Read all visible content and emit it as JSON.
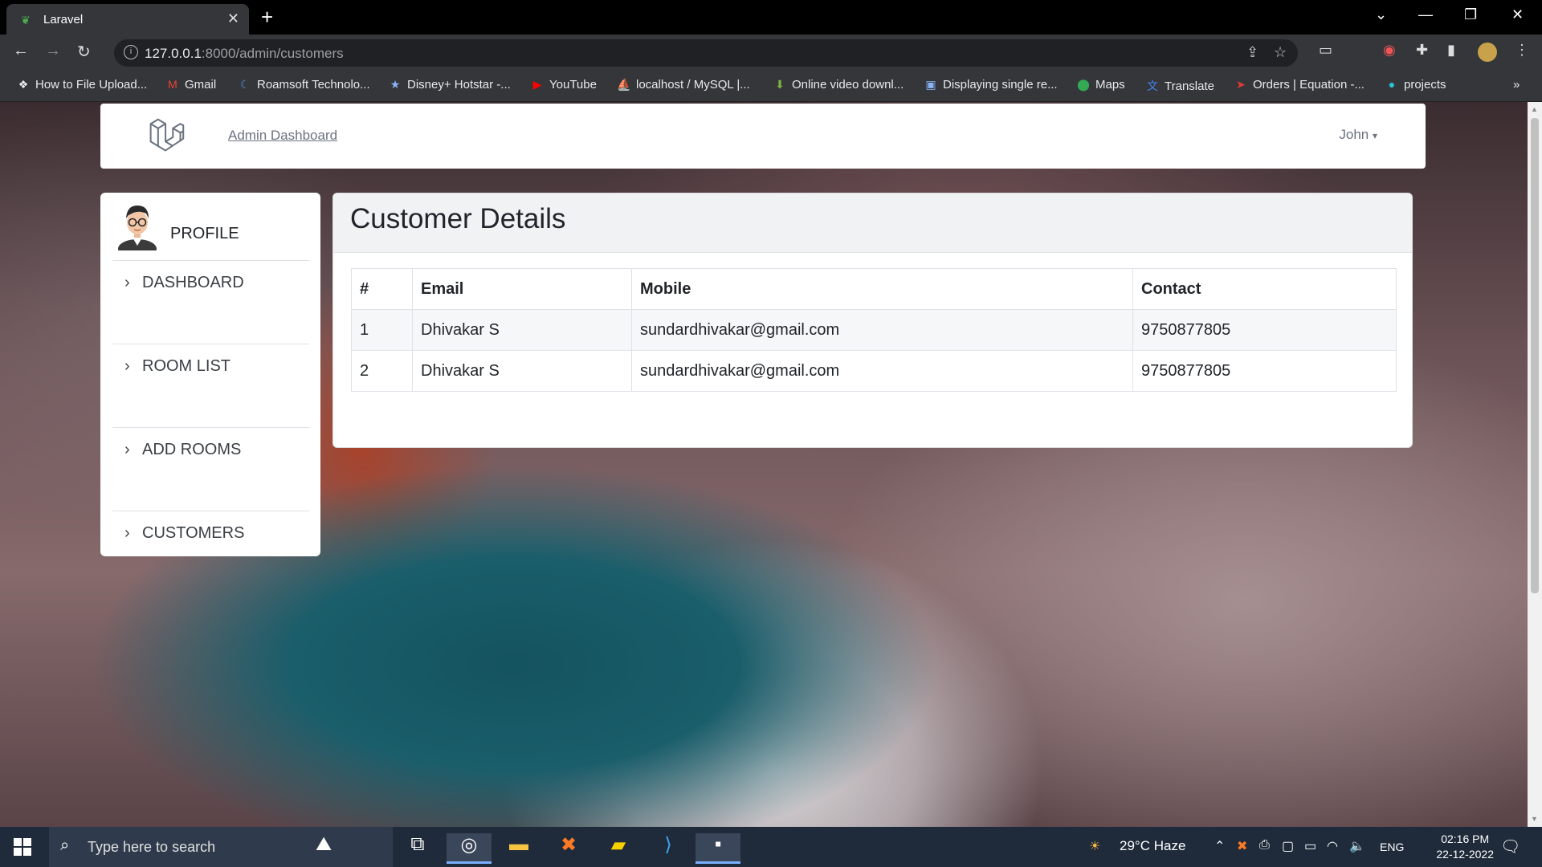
{
  "browser": {
    "tab_title": "Laravel",
    "url_host": "127.0.0.1",
    "url_rest": ":8000/admin/customers",
    "bookmarks": [
      {
        "label": "How to File Upload...",
        "icon": "bookmark-icon"
      },
      {
        "label": "Gmail",
        "icon": "gmail-icon"
      },
      {
        "label": "Roamsoft Technolo...",
        "icon": "roamsoft-icon"
      },
      {
        "label": "Disney+ Hotstar -...",
        "icon": "hotstar-icon"
      },
      {
        "label": "YouTube",
        "icon": "youtube-icon"
      },
      {
        "label": "localhost / MySQL |...",
        "icon": "phpmyadmin-icon"
      },
      {
        "label": "Online video downl...",
        "icon": "download-icon"
      },
      {
        "label": "Displaying single re...",
        "icon": "site-icon"
      },
      {
        "label": "Maps",
        "icon": "maps-icon"
      },
      {
        "label": "Translate",
        "icon": "translate-icon"
      },
      {
        "label": "Orders | Equation -...",
        "icon": "equation-icon"
      },
      {
        "label": "projects",
        "icon": "projects-icon"
      }
    ]
  },
  "navbar": {
    "brand": "Admin Dashboard",
    "user": "John"
  },
  "sidebar": {
    "profile": "PROFILE",
    "items": [
      {
        "label": "DASHBOARD"
      },
      {
        "label": "ROOM LIST"
      },
      {
        "label": "ADD ROOMS"
      },
      {
        "label": "CUSTOMERS"
      }
    ]
  },
  "main": {
    "title": "Customer Details",
    "columns": [
      "#",
      "Email",
      "Mobile",
      "Contact"
    ],
    "rows": [
      [
        "1",
        "Dhivakar S",
        "sundardhivakar@gmail.com",
        "9750877805"
      ],
      [
        "2",
        "Dhivakar S",
        "sundardhivakar@gmail.com",
        "9750877805"
      ]
    ]
  },
  "taskbar": {
    "search_placeholder": "Type here to search",
    "weather": "29°C  Haze",
    "lang": "ENG",
    "time": "02:16 PM",
    "date": "22-12-2022"
  }
}
